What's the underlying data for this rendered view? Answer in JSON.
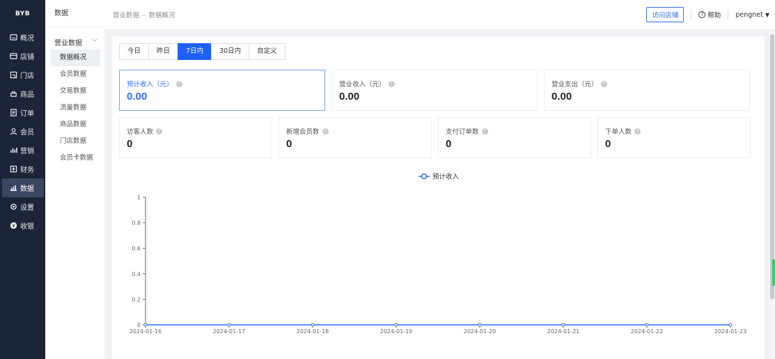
{
  "brand": "BYB",
  "nav": [
    {
      "label": "概况",
      "icon": "overview-icon"
    },
    {
      "label": "店铺",
      "icon": "store-icon"
    },
    {
      "label": "门店",
      "icon": "outlet-icon"
    },
    {
      "label": "商品",
      "icon": "goods-icon"
    },
    {
      "label": "订单",
      "icon": "order-icon"
    },
    {
      "label": "会员",
      "icon": "member-icon"
    },
    {
      "label": "营销",
      "icon": "marketing-icon"
    },
    {
      "label": "财务",
      "icon": "finance-icon"
    },
    {
      "label": "数据",
      "icon": "data-icon",
      "active": true
    },
    {
      "label": "设置",
      "icon": "settings-icon"
    },
    {
      "label": "收银",
      "icon": "cashier-icon"
    }
  ],
  "subnav": {
    "title": "数据",
    "group": "营业数据",
    "items": [
      "数据概况",
      "会员数据",
      "交易数据",
      "流量数据",
      "商品数据",
      "门店数据",
      "会员卡数据"
    ],
    "active_index": 0
  },
  "header": {
    "crumb_parent": "营业数据",
    "crumb_sep": "-",
    "crumb_current": "数据概况",
    "visit_store": "访问店铺",
    "help_icon": "?",
    "help": "帮助",
    "user": "pengnet",
    "user_caret": "▼"
  },
  "tabs": [
    "今日",
    "昨日",
    "7日内",
    "30日内",
    "自定义"
  ],
  "active_tab": 2,
  "stats_row1": [
    {
      "label": "预计收入（元）",
      "value": "0.00",
      "selected": true
    },
    {
      "label": "营业收入（元）",
      "value": "0.00"
    },
    {
      "label": "营业支出（元）",
      "value": "0.00"
    }
  ],
  "stats_row2": [
    {
      "label": "访客人数",
      "value": "0"
    },
    {
      "label": "新增会员数",
      "value": "0"
    },
    {
      "label": "支付订单数",
      "value": "0"
    },
    {
      "label": "下单人数",
      "value": "0"
    }
  ],
  "colors": {
    "accent": "#1e5ff5",
    "line": "#2d6cf6",
    "sidebar": "#1c2438"
  },
  "chart_data": {
    "type": "line",
    "legend_position": "top-center",
    "categories": [
      "2024-01-16",
      "2024-01-17",
      "2024-01-18",
      "2024-01-19",
      "2024-01-20",
      "2024-01-21",
      "2024-01-22",
      "2024-01-23"
    ],
    "series": [
      {
        "name": "预计收入",
        "values": [
          0,
          0,
          0,
          0,
          0,
          0,
          0,
          0
        ]
      }
    ],
    "ylim": [
      0,
      1
    ],
    "yticks": [
      "0",
      "0.2",
      "0.4",
      "0.6",
      "0.8",
      "1"
    ],
    "grid": false
  }
}
